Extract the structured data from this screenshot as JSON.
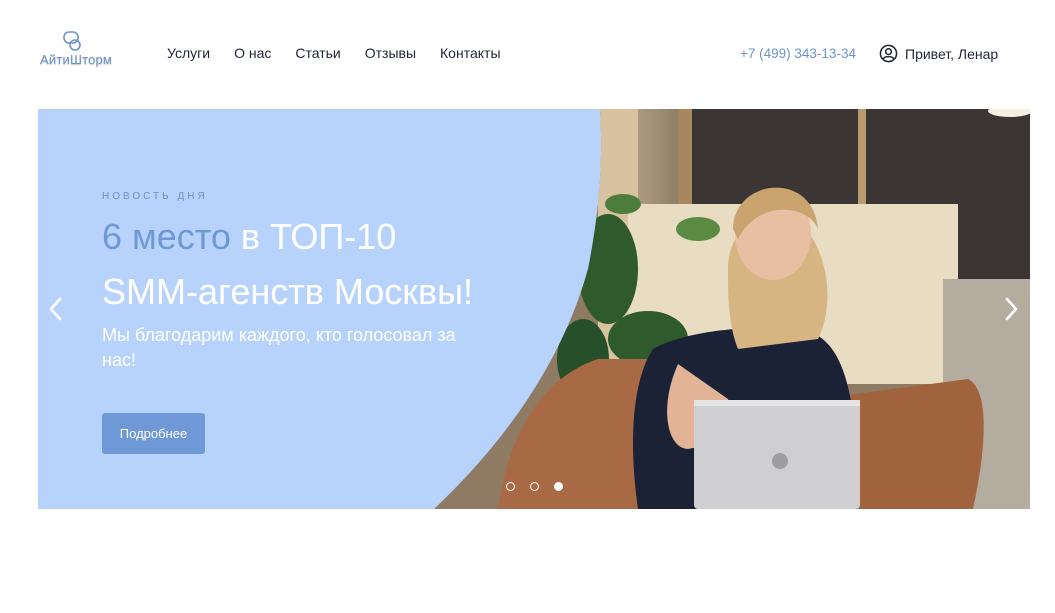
{
  "header": {
    "logo_text": "АйтиШторм",
    "nav": [
      {
        "label": "Услуги"
      },
      {
        "label": "О нас"
      },
      {
        "label": "Статьи"
      },
      {
        "label": "Отзывы"
      },
      {
        "label": "Контакты"
      }
    ],
    "phone": "+7 (499) 343-13-34",
    "user_greeting": "Привет, Ленар",
    "icons": {
      "user": "user-circle-icon",
      "logo": "chat-bubbles-icon"
    }
  },
  "hero": {
    "eyebrow": "Новость дня",
    "title_accent": "6 место",
    "title_rest": " в ТОП-10",
    "title_line2": "SMM-агенств Москвы!",
    "subtitle": "Мы благодарим каждого, кто голосовал за нас!",
    "button_label": "Подробнее",
    "slides_total": 3,
    "active_slide": 3,
    "icons": {
      "prev": "chevron-left-icon",
      "next": "chevron-right-icon"
    }
  },
  "colors": {
    "accent": "#6e99d6",
    "panel": "#b7d3fc",
    "text": "#1f2533"
  }
}
